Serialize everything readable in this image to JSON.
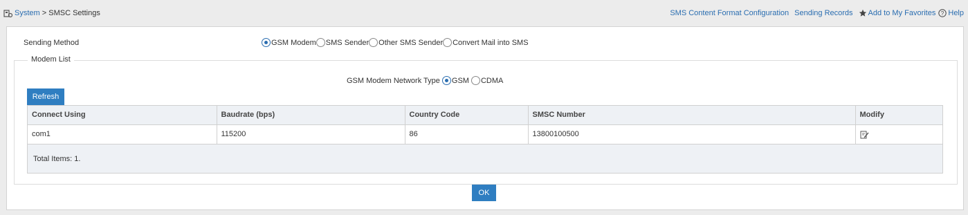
{
  "breadcrumb": {
    "root": "System",
    "separator": ">",
    "current": "SMSC Settings"
  },
  "top_links": {
    "content_format": "SMS Content Format Configuration",
    "sending_records": "Sending Records",
    "favorites": "Add to My Favorites",
    "help": "Help"
  },
  "sending_method": {
    "label": "Sending Method",
    "options": [
      "GSM Modem",
      "SMS Sender",
      "Other SMS Sender",
      "Convert Mail into SMS"
    ],
    "selected": "GSM Modem"
  },
  "modem_list": {
    "legend": "Modem List",
    "network_type_label": "GSM Modem Network Type",
    "network_options": [
      "GSM",
      "CDMA"
    ],
    "network_selected": "GSM",
    "refresh_label": "Refresh",
    "columns": [
      "Connect Using",
      "Baudrate (bps)",
      "Country Code",
      "SMSC Number",
      "Modify"
    ],
    "rows": [
      {
        "connect_using": "com1",
        "baudrate": "115200",
        "country_code": "86",
        "smsc_number": "13800100500"
      }
    ],
    "total_label": "Total Items: 1."
  },
  "ok_label": "OK",
  "colors": {
    "accent": "#2f7ec1",
    "link": "#2a6db0"
  },
  "icons": [
    "settings-icon",
    "star-icon",
    "help-icon",
    "edit-icon"
  ]
}
